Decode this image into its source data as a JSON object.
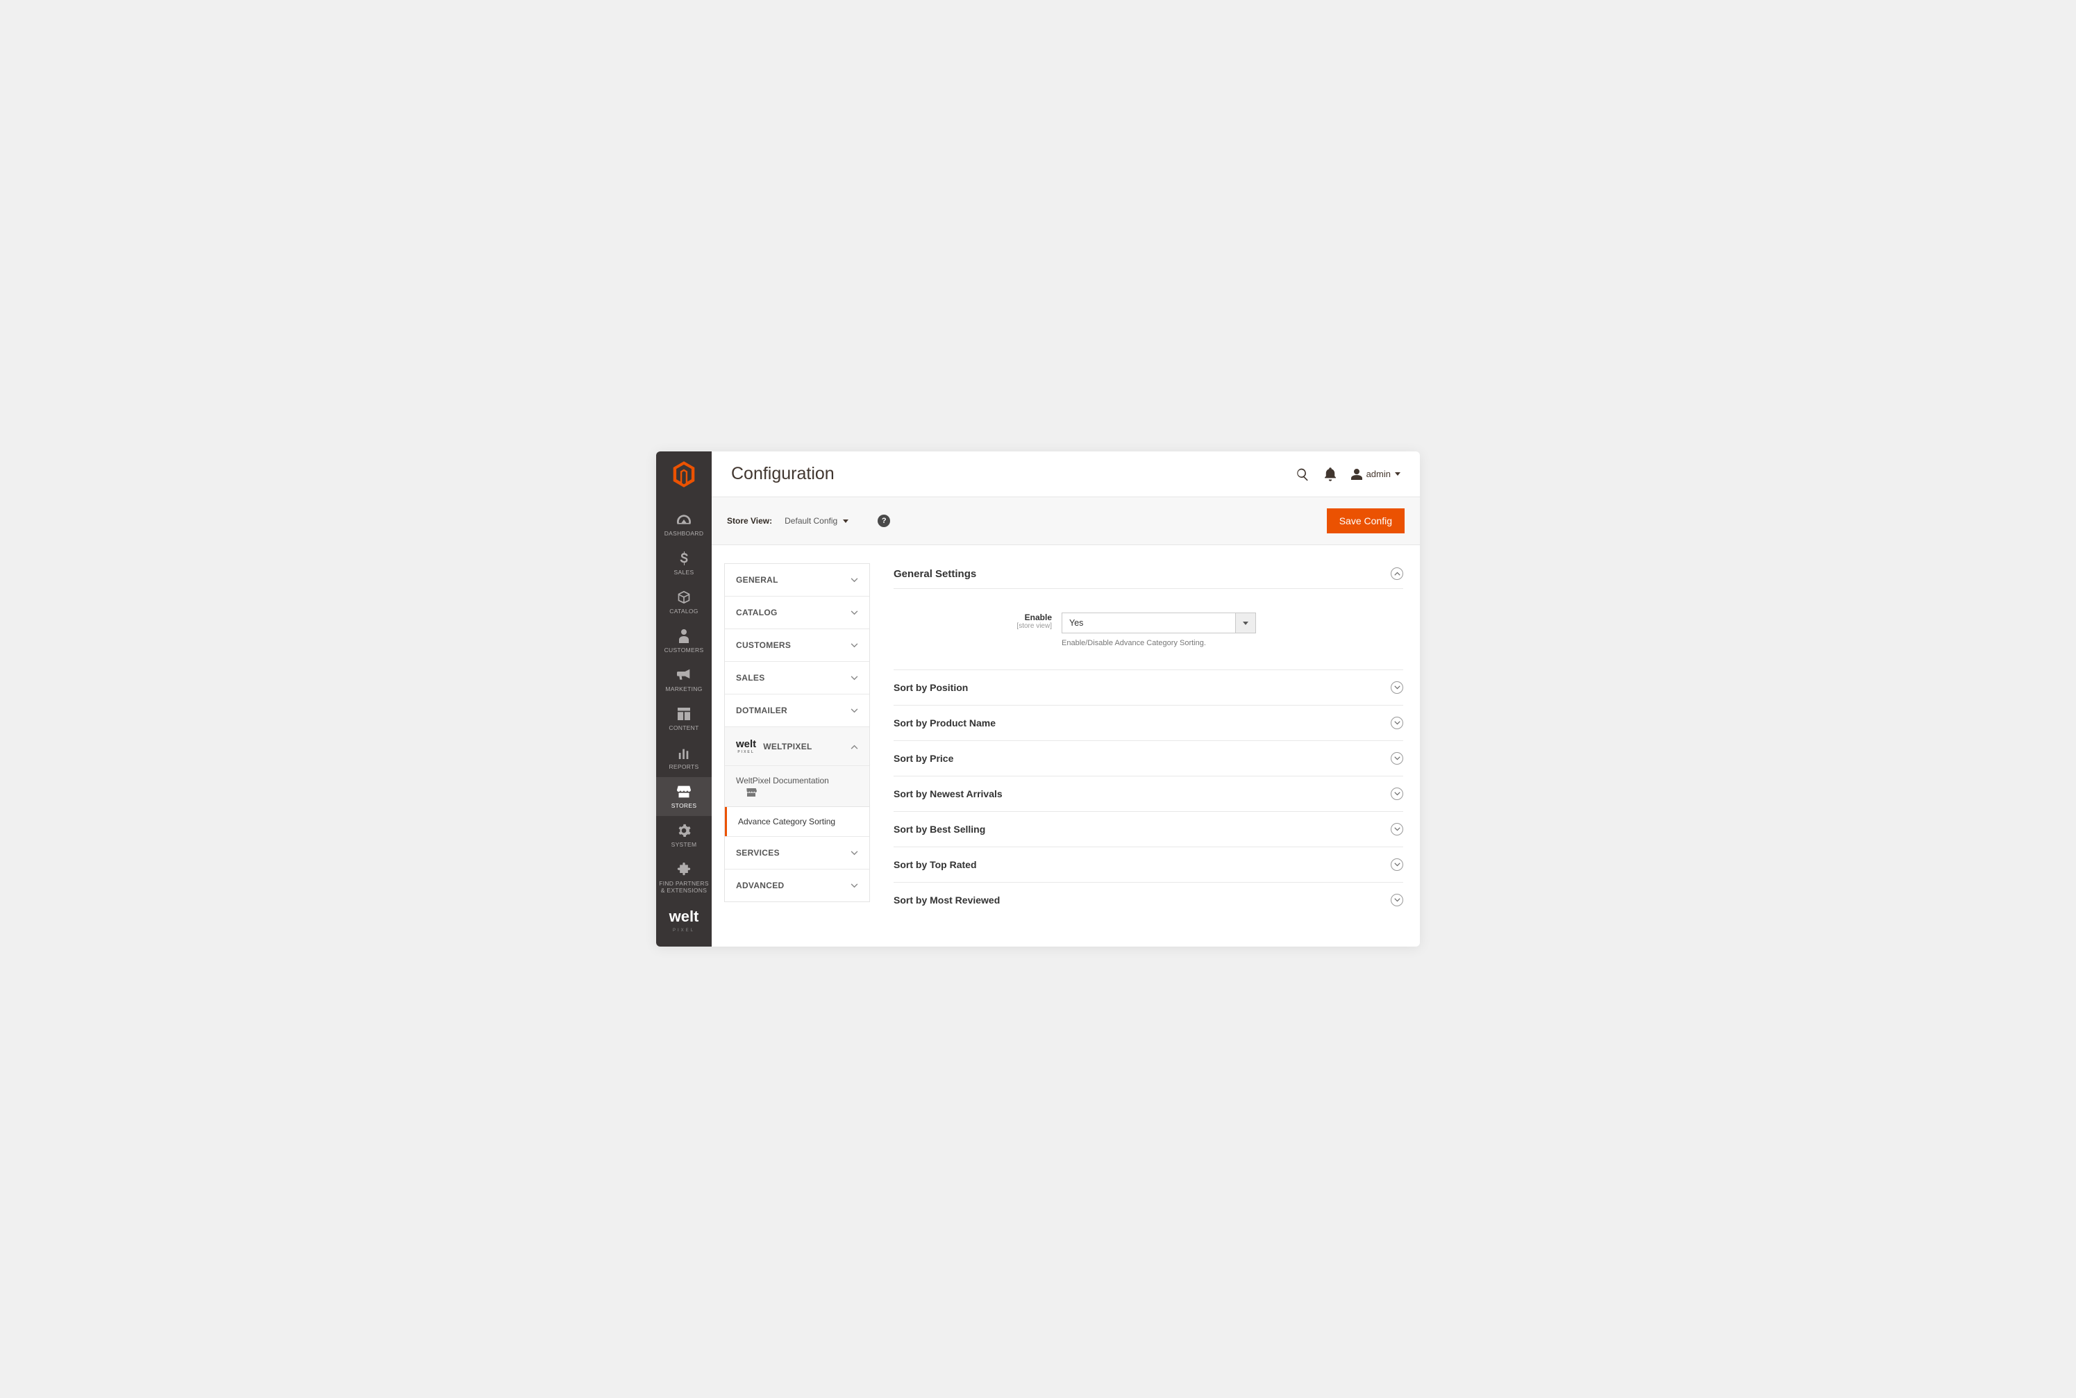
{
  "page_title": "Configuration",
  "user_label": "admin",
  "topbar": {
    "store_view_label": "Store View:",
    "store_view_value": "Default Config",
    "save_button": "Save Config"
  },
  "nav": [
    {
      "name": "dashboard",
      "label": "DASHBOARD"
    },
    {
      "name": "sales",
      "label": "SALES"
    },
    {
      "name": "catalog",
      "label": "CATALOG"
    },
    {
      "name": "customers",
      "label": "CUSTOMERS"
    },
    {
      "name": "marketing",
      "label": "MARKETING"
    },
    {
      "name": "content",
      "label": "CONTENT"
    },
    {
      "name": "reports",
      "label": "REPORTS"
    },
    {
      "name": "stores",
      "label": "STORES"
    },
    {
      "name": "system",
      "label": "SYSTEM"
    },
    {
      "name": "partners",
      "label": "FIND PARTNERS & EXTENSIONS"
    }
  ],
  "config_tabs": [
    {
      "label": "GENERAL",
      "expanded": false
    },
    {
      "label": "CATALOG",
      "expanded": false
    },
    {
      "label": "CUSTOMERS",
      "expanded": false
    },
    {
      "label": "SALES",
      "expanded": false
    },
    {
      "label": "DOTMAILER",
      "expanded": false
    },
    {
      "label": "WELTPIXEL",
      "expanded": true,
      "sub": [
        {
          "label": "WeltPixel Documentation",
          "active": false,
          "doc": true
        },
        {
          "label": "Advance Category Sorting",
          "active": true
        }
      ]
    },
    {
      "label": "SERVICES",
      "expanded": false
    },
    {
      "label": "ADVANCED",
      "expanded": false
    }
  ],
  "main": {
    "general_section_title": "General Settings",
    "enable": {
      "label": "Enable",
      "scope": "[store view]",
      "value": "Yes",
      "help": "Enable/Disable Advance Category Sorting."
    },
    "sort_sections": [
      "Sort by Position",
      "Sort by Product Name",
      "Sort by Price",
      "Sort by Newest Arrivals",
      "Sort by Best Selling",
      "Sort by Top Rated",
      "Sort by Most Reviewed"
    ]
  }
}
